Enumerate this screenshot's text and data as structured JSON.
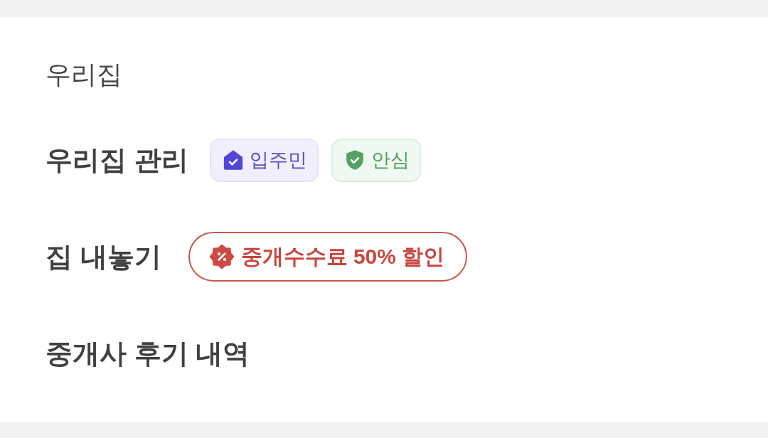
{
  "section": {
    "title": "우리집"
  },
  "menu": [
    {
      "label": "우리집 관리",
      "badges": [
        {
          "kind": "resident",
          "label": "입주민"
        },
        {
          "kind": "safe",
          "label": "안심"
        }
      ]
    },
    {
      "label": "집 내놓기",
      "badges": [
        {
          "kind": "discount",
          "label": "중개수수료 50% 할인"
        }
      ]
    },
    {
      "label": "중개사 후기 내역"
    }
  ]
}
